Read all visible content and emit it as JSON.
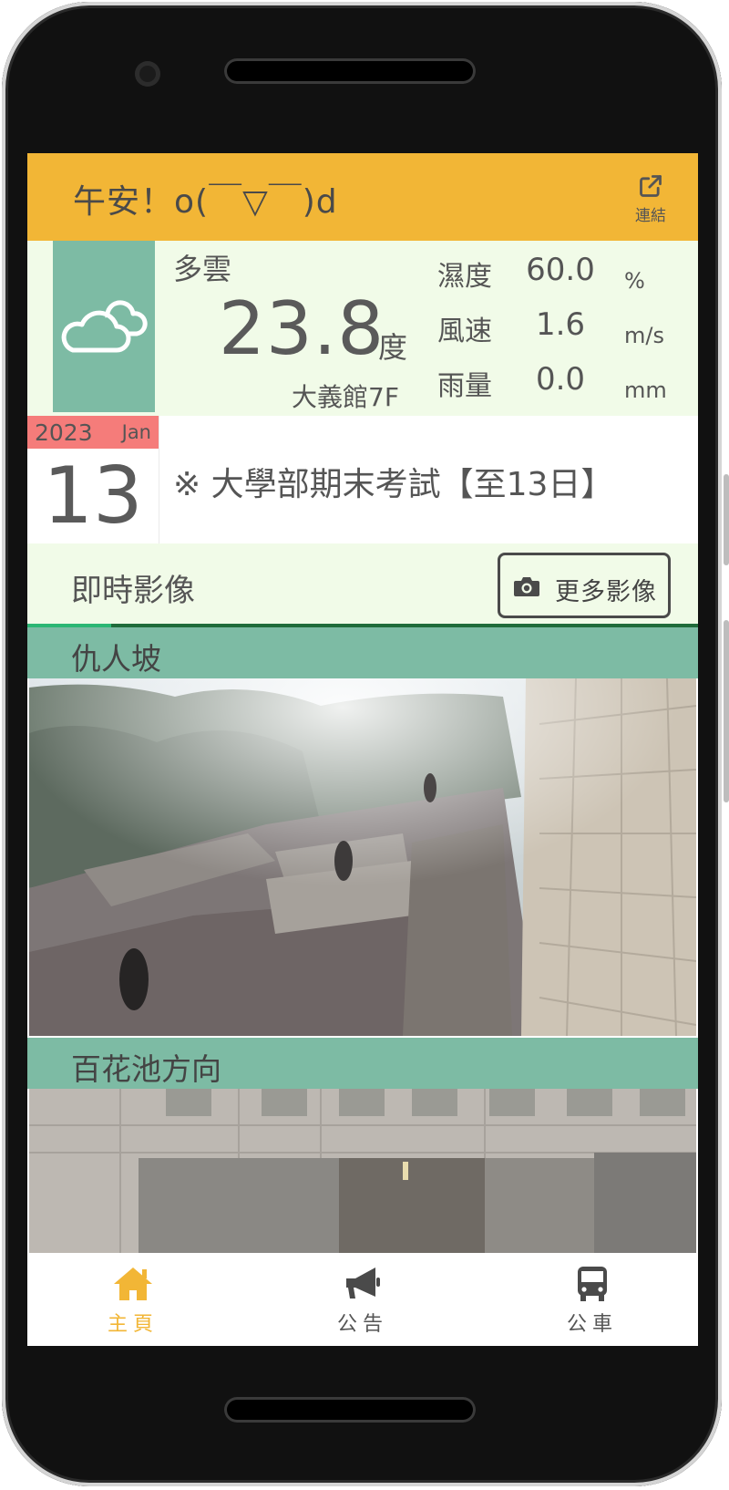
{
  "header": {
    "greeting": "午安！o(￣▽￣)d",
    "link_label": "連結",
    "link_icon": "external-link-icon",
    "background": "#F2B636"
  },
  "weather": {
    "condition": "多雲",
    "icon": "cloud-icon",
    "temperature": "23.8",
    "temperature_unit": "度",
    "location": "大義館7F",
    "stats": [
      {
        "label": "濕度",
        "value": "60.0",
        "unit": "%"
      },
      {
        "label": "風速",
        "value": "1.6",
        "unit": "m/s"
      },
      {
        "label": "雨量",
        "value": "0.0",
        "unit": "mm"
      }
    ]
  },
  "calendar": {
    "year": "2023",
    "month": "Jan",
    "day": "13",
    "event": "※ 大學部期末考試【至13日】"
  },
  "live": {
    "title": "即時影像",
    "more_button": "更多影像",
    "more_icon": "camera-icon",
    "progress": 0.125,
    "cameras": [
      {
        "title": "仇人坡"
      },
      {
        "title": "百花池方向"
      }
    ]
  },
  "bottom_nav": {
    "active_color": "#F2B636",
    "items": [
      {
        "label": "主頁",
        "icon": "home-icon",
        "active": true
      },
      {
        "label": "公告",
        "icon": "megaphone-icon",
        "active": false
      },
      {
        "label": "公車",
        "icon": "bus-icon",
        "active": false
      }
    ]
  }
}
